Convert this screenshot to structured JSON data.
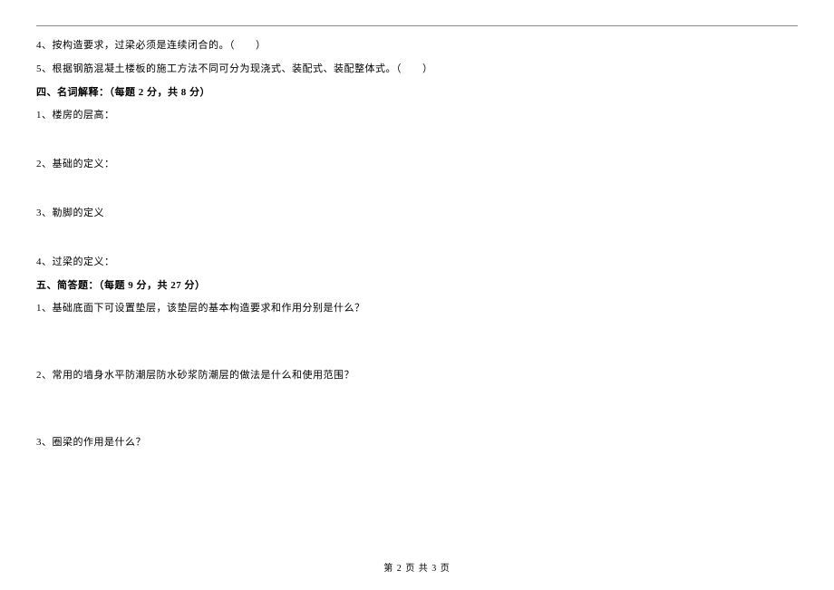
{
  "tf": {
    "q4": "4、按构造要求，过梁必须是连续闭合的。（　　）",
    "q5": "5、根据钢筋混凝土楼板的施工方法不同可分为现浇式、装配式、装配整体式。（　　）"
  },
  "section4": {
    "header": "四、名词解释：（每题 2 分，共 8 分）",
    "q1": "1、楼房的层高：",
    "q2": "2、基础的定义：",
    "q3": "3、勒脚的定义",
    "q4": "4、过梁的定义："
  },
  "section5": {
    "header": "五、简答题：（每题 9 分，共 27 分）",
    "q1": "1、基础底面下可设置垫层，该垫层的基本构造要求和作用分别是什么？",
    "q2": "2、常用的墙身水平防潮层防水砂浆防潮层的做法是什么和使用范围？",
    "q3": "3、圈梁的作用是什么？"
  },
  "footer": "第 2 页 共 3 页"
}
